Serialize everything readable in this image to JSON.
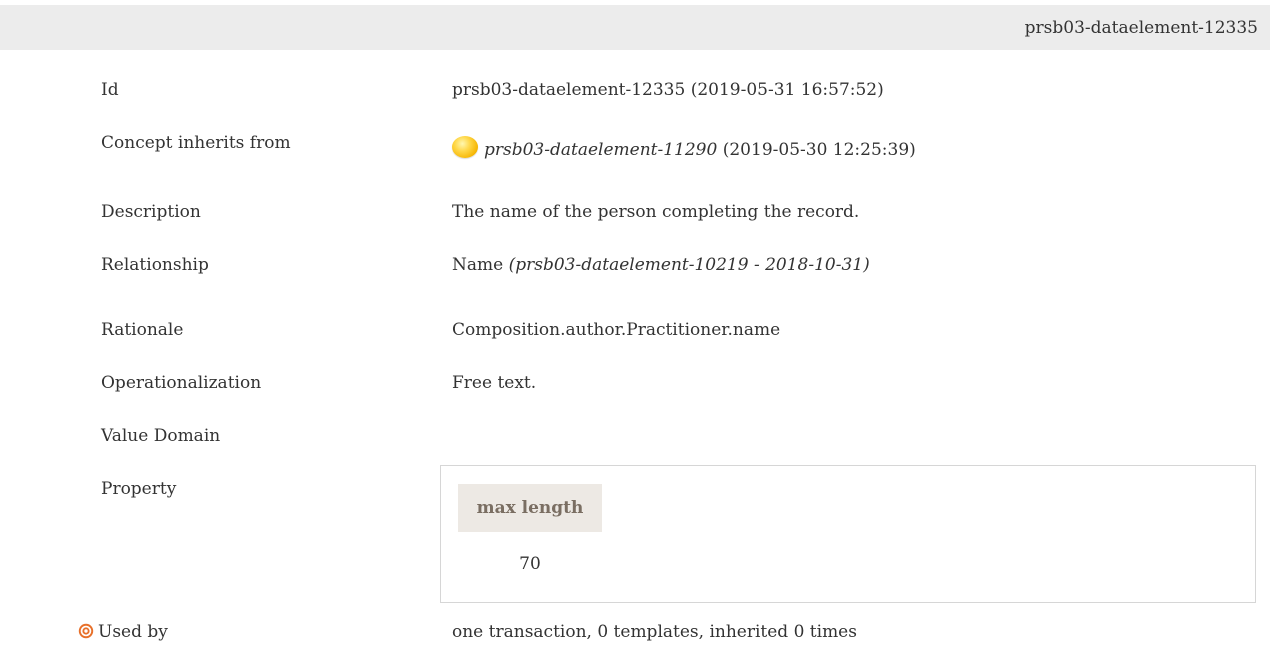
{
  "header": {
    "title": "prsb03-dataelement-12335"
  },
  "rows": {
    "id": {
      "label": "Id",
      "value": "prsb03-dataelement-12335 (2019-05-31 16:57:52)"
    },
    "inherits": {
      "label": "Concept inherits from",
      "status_icon": "status-dot-icon",
      "status_color": "#f5b400",
      "link": "prsb03-dataelement-11290",
      "date": "(2019-05-30 12:25:39)"
    },
    "description": {
      "label": "Description",
      "value": "The name of the person completing the record."
    },
    "relationship": {
      "label": "Relationship",
      "value": "Name",
      "ref": "(prsb03-dataelement-10219 - 2018-10-31)"
    },
    "rationale": {
      "label": "Rationale",
      "value": "Composition.author.Practitioner.name"
    },
    "operationalization": {
      "label": "Operationalization",
      "value": "Free text."
    },
    "value_domain": {
      "label": "Value Domain"
    },
    "property": {
      "label": "Property",
      "header": "max length",
      "value": "70",
      "header_bg": "#ede9e4",
      "header_color": "#7a6e62"
    },
    "used_by": {
      "icon": "target-icon",
      "icon_color": "#e8702a",
      "label": "Used by",
      "value": "one transaction, 0 templates, inherited 0 times"
    }
  }
}
